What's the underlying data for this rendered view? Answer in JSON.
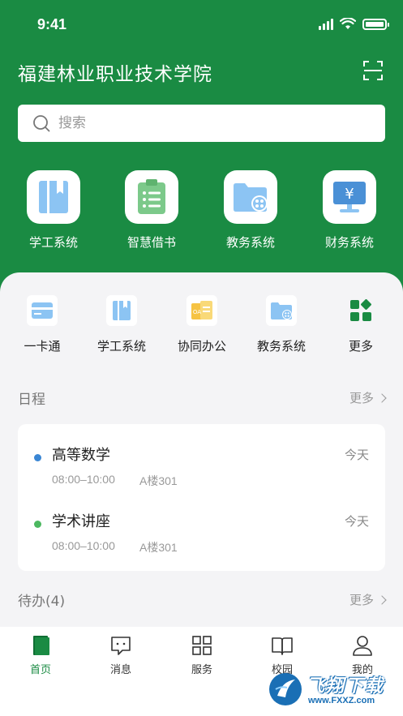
{
  "status_bar": {
    "time": "9:41"
  },
  "header": {
    "title": "福建林业职业技术学院"
  },
  "search": {
    "placeholder": "搜索"
  },
  "top_apps": [
    {
      "label": "学工系统",
      "icon": "book-icon"
    },
    {
      "label": "智慧借书",
      "icon": "clipboard-list-icon"
    },
    {
      "label": "教务系统",
      "icon": "folder-grid-icon"
    },
    {
      "label": "财务系统",
      "icon": "yuan-monitor-icon"
    }
  ],
  "quick_apps": [
    {
      "label": "一卡通",
      "icon": "card-icon"
    },
    {
      "label": "学工系统",
      "icon": "book-icon"
    },
    {
      "label": "协同办公",
      "icon": "oa-doc-icon"
    },
    {
      "label": "教务系统",
      "icon": "folder-grid-icon"
    },
    {
      "label": "更多",
      "icon": "apps-grid-icon"
    }
  ],
  "schedule": {
    "title": "日程",
    "more": "更多",
    "events": [
      {
        "title": "高等数学",
        "day": "今天",
        "time": "08:00–10:00",
        "room": "A楼301",
        "dot_color": "#3a86d4"
      },
      {
        "title": "学术讲座",
        "day": "今天",
        "time": "08:00–10:00",
        "room": "A楼301",
        "dot_color": "#4cb860"
      }
    ]
  },
  "todo": {
    "title": "待办(4)",
    "more": "更多"
  },
  "tabbar": {
    "tabs": [
      {
        "label": "首页",
        "icon": "home-doc-icon",
        "active": true
      },
      {
        "label": "消息",
        "icon": "message-icon",
        "active": false
      },
      {
        "label": "服务",
        "icon": "grid-icon",
        "active": false
      },
      {
        "label": "校园",
        "icon": "open-book-icon",
        "active": false
      },
      {
        "label": "我的",
        "icon": "person-icon",
        "active": false
      }
    ]
  },
  "watermark": {
    "text": "飞翔下载",
    "url": "www.FXXZ.com"
  },
  "colors": {
    "brand_green": "#1a8b43",
    "tile_blue": "#8cc4f3",
    "tile_green": "#7cc98a"
  }
}
